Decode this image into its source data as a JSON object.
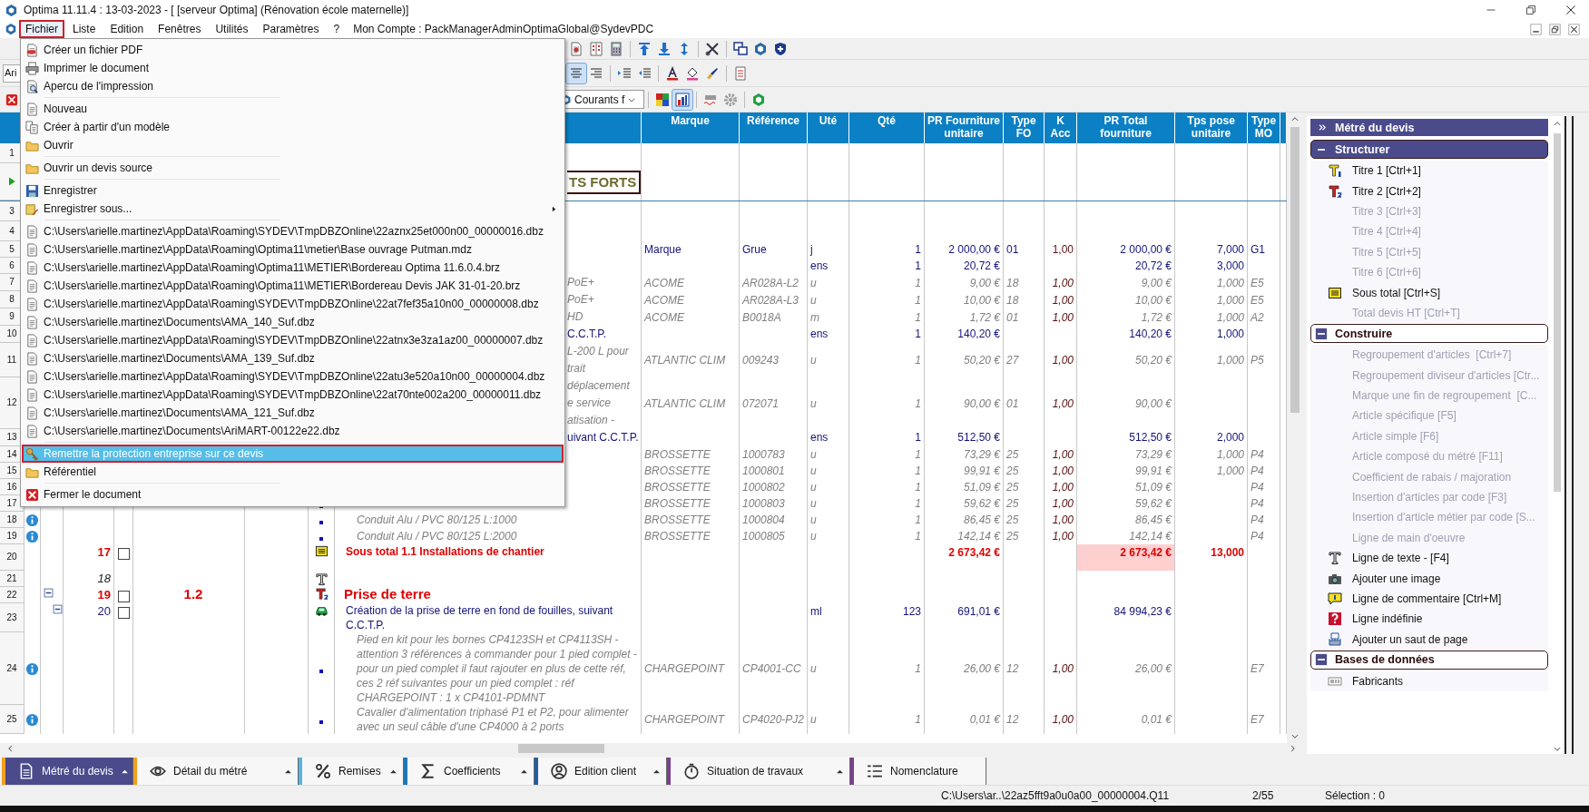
{
  "window": {
    "title": "Optima 11.11.4 : 13-03-2023 - [ [serveur Optima] (Rénovation école maternelle)]"
  },
  "menu_bar": {
    "items": [
      {
        "label": "Fichier",
        "selected": true
      },
      {
        "label": "Liste",
        "selected": false
      },
      {
        "label": "Edition",
        "selected": false
      },
      {
        "label": "Fenêtres",
        "selected": false
      },
      {
        "label": "Utilités",
        "selected": false
      },
      {
        "label": "Paramètres",
        "selected": false
      },
      {
        "label": "?",
        "selected": false
      }
    ],
    "account": "Mon Compte : PackManagerAdminOptimaGlobal@SydevPDC"
  },
  "toolbars": [
    {
      "buttons": [
        {
          "pressed": false
        },
        {
          "pressed": false
        },
        {
          "pressed": false
        },
        {
          "pressed": false
        },
        {
          "pressed": false
        },
        {
          "pressed": false
        },
        {
          "pressed": false
        },
        {
          "pressed": false
        },
        {
          "pressed": false
        },
        {
          "pressed": false
        }
      ]
    },
    {
      "font_box": "Ari",
      "buttons": [
        {
          "pressed": true
        },
        {
          "pressed": false
        },
        {
          "pressed": false
        },
        {
          "pressed": false
        },
        {
          "pressed": false
        },
        {
          "pressed": false
        },
        {
          "pressed": false
        },
        {
          "pressed": false
        }
      ]
    },
    {
      "style_box": "Courants f",
      "buttons": [
        {
          "pressed": false
        },
        {
          "pressed": true
        },
        {
          "pressed": false
        },
        {
          "pressed": false
        },
        {
          "pressed": false
        }
      ]
    }
  ],
  "file_menu": {
    "items": [
      {
        "kind": "item",
        "label": "Créer un fichier PDF",
        "selected": false
      },
      {
        "kind": "item",
        "label": "Imprimer le document",
        "selected": false
      },
      {
        "kind": "item",
        "label": "Apercu de l'impression",
        "selected": false
      },
      {
        "kind": "separator"
      },
      {
        "kind": "item",
        "label": "Nouveau",
        "selected": false
      },
      {
        "kind": "item",
        "label": "Créer à partir d'un modèle",
        "selected": false
      },
      {
        "kind": "item",
        "label": "Ouvrir",
        "selected": false
      },
      {
        "kind": "separator"
      },
      {
        "kind": "item",
        "label": "Ouvrir un devis source",
        "selected": false
      },
      {
        "kind": "separator"
      },
      {
        "kind": "item",
        "label": "Enregistrer",
        "selected": false
      },
      {
        "kind": "submenu",
        "label": "Enregistrer sous...",
        "selected": false
      },
      {
        "kind": "separator"
      },
      {
        "kind": "file",
        "label": "C:\\Users\\arielle.martinez\\AppData\\Roaming\\SYDEV\\TmpDBZOnline\\22aznx25et000n00_00000016.dbz",
        "selected": false
      },
      {
        "kind": "file",
        "label": "C:\\Users\\arielle.martinez\\AppData\\Roaming\\Optima11\\metier\\Base ouvrage Putman.mdz",
        "selected": false
      },
      {
        "kind": "file",
        "label": "C:\\Users\\arielle.martinez\\AppData\\Roaming\\Optima11\\METIER\\Bordereau Optima 11.6.0.4.brz",
        "selected": false
      },
      {
        "kind": "file",
        "label": "C:\\Users\\arielle.martinez\\AppData\\Roaming\\Optima11\\METIER\\Bordereau Devis JAK 31-01-20.brz",
        "selected": false
      },
      {
        "kind": "file",
        "label": "C:\\Users\\arielle.martinez\\AppData\\Roaming\\SYDEV\\TmpDBZOnline\\22at7fef35a10n00_00000008.dbz",
        "selected": false
      },
      {
        "kind": "file",
        "label": "C:\\Users\\arielle.martinez\\Documents\\AMA_140_Suf.dbz",
        "selected": false
      },
      {
        "kind": "file",
        "label": "C:\\Users\\arielle.martinez\\AppData\\Roaming\\SYDEV\\TmpDBZOnline\\22atnx3e3za1az00_00000007.dbz",
        "selected": false
      },
      {
        "kind": "file",
        "label": "C:\\Users\\arielle.martinez\\Documents\\AMA_139_Suf.dbz",
        "selected": false
      },
      {
        "kind": "file",
        "label": "C:\\Users\\arielle.martinez\\AppData\\Roaming\\SYDEV\\TmpDBZOnline\\22atu3e520a10n00_00000004.dbz",
        "selected": false
      },
      {
        "kind": "file",
        "label": "C:\\Users\\arielle.martinez\\AppData\\Roaming\\SYDEV\\TmpDBZOnline\\22at70nte002a200_00000011.dbz",
        "selected": false
      },
      {
        "kind": "file",
        "label": "C:\\Users\\arielle.martinez\\Documents\\AMA_121_Suf.dbz",
        "selected": false
      },
      {
        "kind": "file",
        "label": "C:\\Users\\arielle.martinez\\Documents\\AriMART-00122e22.dbz",
        "selected": false
      },
      {
        "kind": "separator"
      },
      {
        "kind": "item",
        "label": "Remettre la protection entreprise sur ce devis",
        "selected": true
      },
      {
        "kind": "item",
        "label": "Référentiel",
        "selected": false
      },
      {
        "kind": "separator"
      },
      {
        "kind": "item",
        "label": "Fermer le document",
        "selected": false
      }
    ]
  },
  "table": {
    "columns": [
      "Marque",
      "Référence",
      "Uté",
      "Qté",
      "PR Fourniture\nunitaire",
      "Type\nFO",
      "K\nAcc",
      "PR Total\nfourniture",
      "Tps pose\nunitaire",
      "Type\nMO"
    ],
    "rows": [
      {
        "num": "1",
        "kind": "blank",
        "current": false,
        "info": false
      },
      {
        "kind": "title1",
        "current": true,
        "info": false,
        "description_tail": "TS FORTS"
      },
      {
        "num": "3",
        "kind": "blank",
        "current": false,
        "info": false
      },
      {
        "num": "4",
        "kind": "blank",
        "current": false,
        "info": false
      },
      {
        "num": "5",
        "kind": "article",
        "current": false,
        "info": false,
        "cells": [
          "Marque",
          "Grue",
          "j",
          "1",
          "2 000,00 €",
          "01",
          "1,00",
          "2 000,00 €",
          "7,000",
          "G1"
        ]
      },
      {
        "num": "6",
        "kind": "article",
        "current": false,
        "info": false,
        "cells": [
          null,
          null,
          "ens",
          "1",
          "20,72 €",
          null,
          null,
          "20,72 €",
          "3,000",
          null
        ]
      },
      {
        "num": "7",
        "kind": "sub",
        "current": false,
        "info": false,
        "description_tail": "PoE+",
        "cells": [
          "ACOME",
          "AR028A-L2",
          "u",
          "1",
          "9,00 €",
          "18",
          "1,00",
          "9,00 €",
          "1,000",
          "E5"
        ]
      },
      {
        "num": "8",
        "kind": "sub",
        "current": false,
        "info": false,
        "description_tail": "PoE+",
        "cells": [
          "ACOME",
          "AR028A-L3",
          "u",
          "1",
          "10,00 €",
          "18",
          "1,00",
          "10,00 €",
          "1,000",
          "E5"
        ]
      },
      {
        "num": "9",
        "kind": "sub",
        "current": false,
        "info": false,
        "description_tail": "HD",
        "cells": [
          "ACOME",
          "B0018A",
          "m",
          "1",
          "1,72 €",
          "01",
          "1,00",
          "1,72 €",
          "1,000",
          "A2"
        ]
      },
      {
        "num": "10",
        "kind": "article",
        "current": false,
        "info": false,
        "description_tail": "C.C.T.P.",
        "cells": [
          null,
          null,
          "ens",
          "1",
          "140,20 €",
          null,
          null,
          "140,20 €",
          "1,000",
          null
        ]
      },
      {
        "num": "11",
        "kind": "sub",
        "current": false,
        "info": false,
        "description_tail": "L-200 L pour\ntrait",
        "cells": [
          "ATLANTIC CLIM",
          "009243",
          "u",
          "1",
          "50,20 €",
          "27",
          "1,00",
          "50,20 €",
          "1,000",
          "P5"
        ]
      },
      {
        "num": "12",
        "kind": "sub",
        "current": false,
        "info": false,
        "description_tail": "déplacement\ne service\natisation -",
        "cells": [
          "ATLANTIC CLIM",
          "072071",
          "u",
          "1",
          "90,00 €",
          "01",
          "1,00",
          "90,00 €",
          null,
          null
        ]
      },
      {
        "num": "13",
        "kind": "article",
        "current": false,
        "info": false,
        "description_tail": "uivant C.C.T.P.",
        "cells": [
          null,
          null,
          "ens",
          "1",
          "512,50 €",
          null,
          null,
          "512,50 €",
          "2,000",
          null
        ]
      },
      {
        "num": "14",
        "kind": "sub",
        "current": false,
        "info": false,
        "cells": [
          "BROSSETTE",
          "1000783",
          "u",
          "1",
          "73,29 €",
          "25",
          "1,00",
          "73,29 €",
          "1,000",
          "P4"
        ]
      },
      {
        "num": "15",
        "kind": "sub",
        "current": false,
        "info": false,
        "cells": [
          "BROSSETTE",
          "1000801",
          "u",
          "1",
          "99,91 €",
          "25",
          "1,00",
          "99,91 €",
          "1,000",
          "P4"
        ]
      },
      {
        "num": "16",
        "kind": "sub",
        "current": false,
        "info": false,
        "cells": [
          "BROSSETTE",
          "1000802",
          "u",
          "1",
          "51,09 €",
          "25",
          "1,00",
          "51,09 €",
          null,
          "P4"
        ]
      },
      {
        "num": "17",
        "kind": "sub",
        "current": false,
        "info": false,
        "cells": [
          "BROSSETTE",
          "1000803",
          "u",
          "1",
          "59,62 €",
          "25",
          "1,00",
          "59,62 €",
          null,
          "P4"
        ]
      },
      {
        "num": "18",
        "kind": "sub",
        "current": false,
        "info": true,
        "description": "Conduit Alu / PVC 80/125 L:1000",
        "cells": [
          "BROSSETTE",
          "1000804",
          "u",
          "1",
          "86,45 €",
          "25",
          "1,00",
          "86,45 €",
          null,
          "P4"
        ]
      },
      {
        "num": "19",
        "kind": "sub",
        "current": false,
        "info": true,
        "description": "Conduit Alu / PVC 80/125 L:2000",
        "cells": [
          "BROSSETTE",
          "1000805",
          "u",
          "1",
          "142,14 €",
          "25",
          "1,00",
          "142,14 €",
          null,
          "P4"
        ]
      },
      {
        "num": "20",
        "kind": "subtotal",
        "current": false,
        "info": false,
        "number": "17",
        "checked": false,
        "description": "Sous total 1.1 Installations de chantier",
        "cells": [
          null,
          null,
          null,
          null,
          "2 673,42 €",
          null,
          null,
          "2 673,42 €",
          "13,000",
          null
        ]
      },
      {
        "num": "21",
        "kind": "text",
        "current": false,
        "info": false,
        "number": "18"
      },
      {
        "num": "22",
        "kind": "title2",
        "current": false,
        "info": false,
        "expanded": true,
        "number": "19",
        "checked": false,
        "numbering": "1.2",
        "description": "Prise de terre"
      },
      {
        "num": "23",
        "kind": "article",
        "current": false,
        "info": false,
        "expanded": true,
        "number": "20",
        "checked": false,
        "description": "Création de la prise de terre en fond de fouilles, suivant C.C.T.P.",
        "cells": [
          null,
          null,
          "ml",
          "123",
          "691,01 €",
          null,
          null,
          "84 994,23 €",
          null,
          null
        ]
      },
      {
        "num": "24",
        "kind": "sub",
        "current": false,
        "info": true,
        "description": "Pied en kit pour les bornes CP4123SH et CP4113SH - attention 3 références à commander pour 1 pied complet - pour un pied complet il faut rajouter en plus de cette réf, ces 2 réf suivantes pour un pied complet : réf CHARGEPOINT : 1 x CP4101-PDMNT",
        "cells": [
          "CHARGEPOINT",
          "CP4001-CC",
          "u",
          "1",
          "26,00 €",
          "12",
          "1,00",
          "26,00 €",
          null,
          "E7"
        ]
      },
      {
        "num": "25",
        "kind": "sub",
        "current": false,
        "info": true,
        "description": "Cavalier d'alimentation triphasé P1 et P2, pour alimenter avec un seul câble d'une CP4000 à 2 ports",
        "cells": [
          "CHARGEPOINT",
          "CP4020-PJ2",
          "u",
          "1",
          "0,01 €",
          "12",
          "1,00",
          "0,01 €",
          null,
          "E7"
        ]
      }
    ]
  },
  "side_panel": {
    "title": "Métré du devis",
    "sections": [
      {
        "title": "Structurer",
        "selected": true,
        "expanded": true,
        "items": [
          {
            "label": "Titre 1 [Ctrl+1]",
            "disabled": false
          },
          {
            "label": "Titre 2 [Ctrl+2]",
            "disabled": false
          },
          {
            "label": "Titre 3 [Ctrl+3]",
            "disabled": true
          },
          {
            "label": "Titre 4 [Ctrl+4]",
            "disabled": true
          },
          {
            "label": "Titre 5 [Ctrl+5]",
            "disabled": true
          },
          {
            "label": "Titre 6 [Ctrl+6]",
            "disabled": true
          },
          {
            "label": "Sous total [Ctrl+S]",
            "disabled": false
          },
          {
            "label": "Total devis HT [Ctrl+T]",
            "disabled": true
          }
        ]
      },
      {
        "title": "Construire",
        "selected": false,
        "expanded": true,
        "items": [
          {
            "label": "Regroupement d'articles  [Ctrl+7]",
            "disabled": true
          },
          {
            "label": "Regroupement diviseur d'articles [Ctr...",
            "disabled": true
          },
          {
            "label": "Marque une fin de regroupement  [C...",
            "disabled": true
          },
          {
            "label": "Article spécifique [F5]",
            "disabled": true
          },
          {
            "label": "Article simple [F6]",
            "disabled": true
          },
          {
            "label": "Article composé du métré [F11]",
            "disabled": true
          },
          {
            "label": "Coefficient de rabais / majoration",
            "disabled": true
          },
          {
            "label": "Insertion d'articles par code [F3]",
            "disabled": true
          },
          {
            "label": "Insertion d'article métier par code [S...",
            "disabled": true
          },
          {
            "label": "Ligne de main d'oeuvre",
            "disabled": true
          },
          {
            "label": "Ligne de texte - [F4]",
            "disabled": false
          },
          {
            "label": "Ajouter une image",
            "disabled": false
          },
          {
            "label": "Ligne de commentaire [Ctrl+M]",
            "disabled": false
          },
          {
            "label": "Ligne indéfinie",
            "disabled": false
          },
          {
            "label": "Ajouter un saut de page",
            "disabled": false
          }
        ]
      },
      {
        "title": "Bases de données",
        "selected": false,
        "expanded": true,
        "items": [
          {
            "label": "Fabricants",
            "disabled": false
          }
        ]
      }
    ]
  },
  "bottom_tabs": [
    {
      "label": "Métré du devis",
      "selected": true,
      "color": "#f0a020",
      "has_menu": true
    },
    {
      "label": "Détail du métré",
      "selected": false,
      "color": "#f0a020",
      "has_menu": true
    },
    {
      "label": "Remises",
      "selected": false,
      "color": "#5ab4e0",
      "has_menu": true
    },
    {
      "label": "Coefficients",
      "selected": false,
      "color": "#1f78b4",
      "has_menu": true
    },
    {
      "label": "Edition client",
      "selected": false,
      "color": "#1f5fa0",
      "has_menu": true
    },
    {
      "label": "Situation de travaux",
      "selected": false,
      "color": "#7b3f8f",
      "has_menu": true
    },
    {
      "label": "Nomenclature",
      "selected": false,
      "color": "#7b3f8f",
      "has_menu": false
    }
  ],
  "status_bar": {
    "path": "C:\\Users\\ar..\\22az5fft9a0u0a00_00000004.Q11",
    "position": "2/55",
    "selection": "Sélection : 0"
  }
}
